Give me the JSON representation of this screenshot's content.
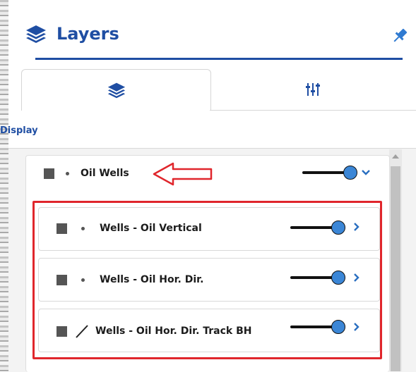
{
  "header": {
    "title": "Layers"
  },
  "tabs": [
    {
      "name": "layers-tab",
      "icon": "layers-icon",
      "active": true
    },
    {
      "name": "settings-tab",
      "icon": "sliders-icon",
      "active": false
    }
  ],
  "section": {
    "label": "Display"
  },
  "layer_group": {
    "label": "Oil Wells",
    "expanded": true,
    "checked": true,
    "visible": true,
    "sublayers": [
      {
        "label": "Wells - Oil Vertical",
        "symbol": "dot-icon",
        "visible": true
      },
      {
        "label": "Wells - Oil Hor. Dir.",
        "symbol": "dot-icon",
        "visible": true
      },
      {
        "label": "Wells - Oil Hor. Dir. Track BH",
        "symbol": "line-icon",
        "visible": true
      }
    ]
  },
  "colors": {
    "accent": "#1f4ea3",
    "annotation": "#e0262c",
    "toggle_knob": "#3b86d6"
  }
}
